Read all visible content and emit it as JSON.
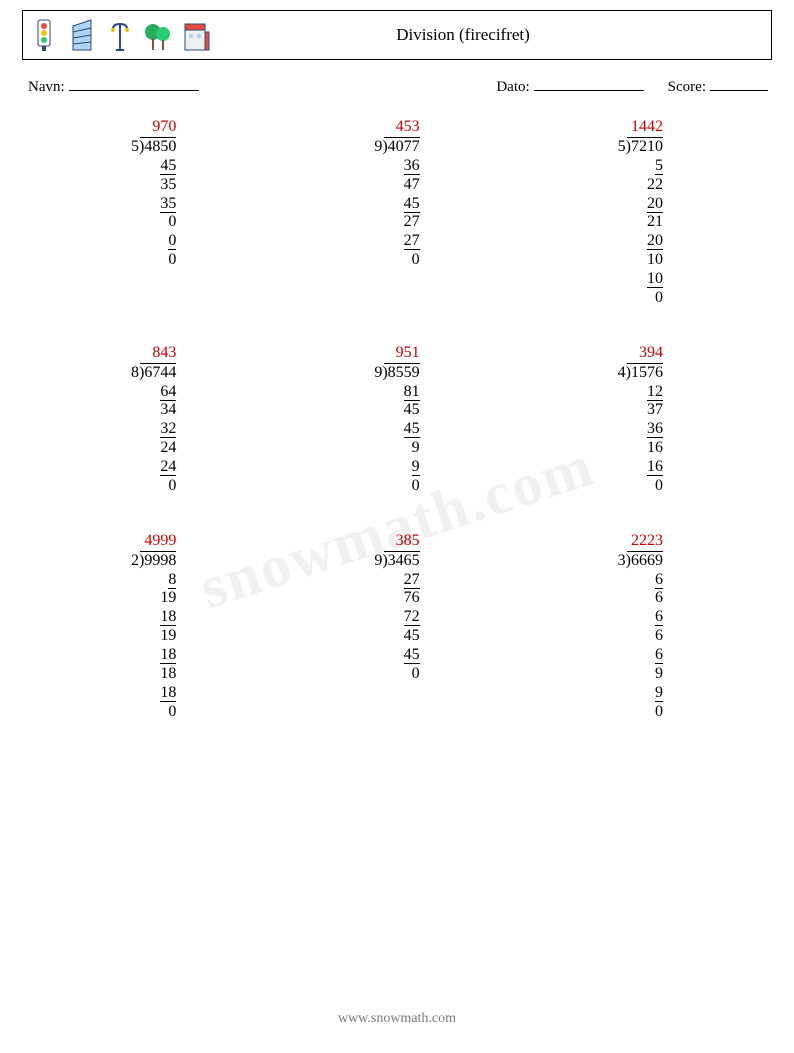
{
  "title": "Division (firecifret)",
  "labels": {
    "name": "Navn:",
    "date": "Dato:",
    "score": "Score:"
  },
  "footer": "www.snowmath.com",
  "watermark": "snowmath.com",
  "icons": [
    "traffic-light-icon",
    "building-icon",
    "street-lamp-icon",
    "trees-icon",
    "shop-icon"
  ],
  "chart_data": {
    "type": "table",
    "title": "Long division worksheet (four-digit dividends)",
    "problems": [
      {
        "divisor": 5,
        "dividend": 4850,
        "quotient": 970,
        "steps": [
          "45",
          "35",
          "35",
          "0",
          "0",
          "0"
        ],
        "bars": [
          0,
          2,
          4
        ]
      },
      {
        "divisor": 9,
        "dividend": 4077,
        "quotient": 453,
        "steps": [
          "36",
          "47",
          "45",
          "27",
          "27",
          "0"
        ],
        "bars": [
          0,
          2,
          4
        ]
      },
      {
        "divisor": 5,
        "dividend": 7210,
        "quotient": 1442,
        "steps": [
          "5",
          "22",
          "20",
          "21",
          "20",
          "10",
          "10",
          "0"
        ],
        "bars": [
          0,
          2,
          4,
          6
        ]
      },
      {
        "divisor": 8,
        "dividend": 6744,
        "quotient": 843,
        "steps": [
          "64",
          "34",
          "32",
          "24",
          "24",
          "0"
        ],
        "bars": [
          0,
          2,
          4
        ]
      },
      {
        "divisor": 9,
        "dividend": 8559,
        "quotient": 951,
        "steps": [
          "81",
          "45",
          "45",
          "9",
          "9",
          "0"
        ],
        "bars": [
          0,
          2,
          4
        ]
      },
      {
        "divisor": 4,
        "dividend": 1576,
        "quotient": 394,
        "steps": [
          "12",
          "37",
          "36",
          "16",
          "16",
          "0"
        ],
        "bars": [
          0,
          2,
          4
        ]
      },
      {
        "divisor": 2,
        "dividend": 9998,
        "quotient": 4999,
        "steps": [
          "8",
          "19",
          "18",
          "19",
          "18",
          "18",
          "18",
          "0"
        ],
        "bars": [
          0,
          2,
          4,
          6
        ]
      },
      {
        "divisor": 9,
        "dividend": 3465,
        "quotient": 385,
        "steps": [
          "27",
          "76",
          "72",
          "45",
          "45",
          "0"
        ],
        "bars": [
          0,
          2,
          4
        ]
      },
      {
        "divisor": 3,
        "dividend": 6669,
        "quotient": 2223,
        "steps": [
          "6",
          "6",
          "6",
          "6",
          "6",
          "9",
          "9",
          "0"
        ],
        "bars": [
          0,
          2,
          4,
          6
        ]
      }
    ]
  }
}
